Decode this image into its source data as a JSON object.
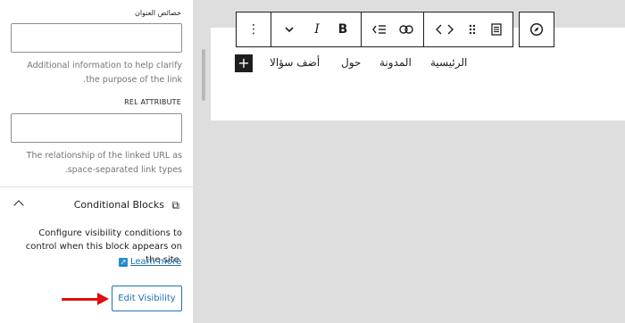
{
  "sidebar": {
    "title_attribute": {
      "label": "خصائص العنوان",
      "value": "",
      "help": "Additional information to help clarify the purpose of the link."
    },
    "rel_attribute": {
      "label": "REL ATTRIBUTE",
      "value": "",
      "help": "The relationship of the linked URL as space-separated link types."
    },
    "conditional_blocks": {
      "title": "Conditional Blocks",
      "description": "Configure visibility conditions to control when this block appears on the site.",
      "learn_more": "Learn more",
      "edit_button": "Edit Visibility"
    }
  },
  "toolbar": {
    "icons": [
      "compass-icon",
      "list-view-icon",
      "drag-handle-icon",
      "code-icon",
      "link-icon",
      "indent-list-icon",
      "bold-icon",
      "italic-icon",
      "chevron-down-icon",
      "more-options-icon"
    ],
    "bold_label": "B",
    "italic_label": "I",
    "more_label": "⋮"
  },
  "navigation": {
    "items": [
      "الرئيسية",
      "المدونة",
      "حول",
      "أضف سؤالا"
    ],
    "add_label": "+"
  },
  "colors": {
    "accent": "#2271b1",
    "annotation_arrow": "#e10e0e",
    "canvas_background": "#dedede"
  }
}
